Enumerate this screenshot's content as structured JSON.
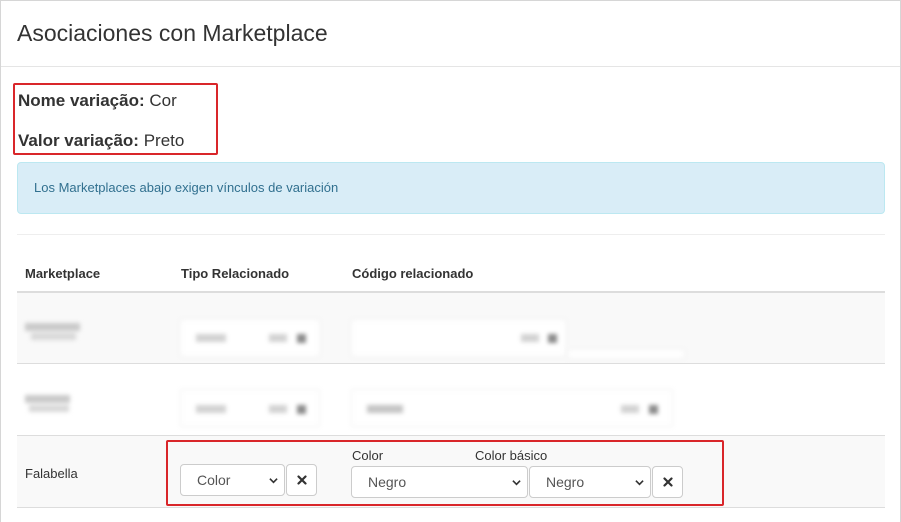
{
  "modal": {
    "title": "Asociaciones con Marketplace"
  },
  "variation": {
    "name_label": "Nome variação:",
    "name_value": "Cor",
    "value_label": "Valor variação:",
    "value_value": "Preto"
  },
  "alert": {
    "text": "Los Marketplaces abajo exigen vínculos de variación"
  },
  "table": {
    "headers": {
      "marketplace": "Marketplace",
      "tipo": "Tipo Relacionado",
      "codigo": "Código relacionado"
    },
    "rows": [
      {
        "marketplace": "",
        "redacted": true
      },
      {
        "marketplace": "",
        "redacted": true
      },
      {
        "marketplace": "Falabella",
        "tipo_select": "Color",
        "color_label": "Color",
        "color_select": "Negro",
        "color_basico_label": "Color básico",
        "color_basico_select": "Negro"
      }
    ]
  },
  "colors": {
    "highlight_border": "#d9262a",
    "alert_bg": "#d9edf7",
    "alert_text": "#31708f",
    "striped_row": "#f9f9f9"
  },
  "icons": {
    "remove": "times-icon",
    "dropdown": "chevron-down-icon"
  }
}
